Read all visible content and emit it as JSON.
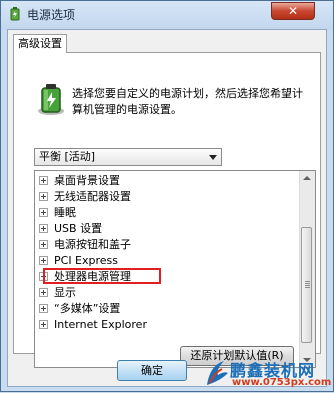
{
  "window": {
    "title": "电源选项",
    "close_glyph": "✕"
  },
  "tabs": [
    {
      "label": "高级设置"
    }
  ],
  "intro_text": "选择您要自定义的电源计划，然后选择您希望计算机管理的电源设置。",
  "plan_select": {
    "value": "平衡 [活动]"
  },
  "settings_tree": [
    {
      "label": "桌面背景设置"
    },
    {
      "label": "无线适配器设置"
    },
    {
      "label": "睡眠"
    },
    {
      "label": "USB 设置"
    },
    {
      "label": "电源按钮和盖子"
    },
    {
      "label": "PCI Express"
    },
    {
      "label": "处理器电源管理",
      "highlighted": true
    },
    {
      "label": "显示"
    },
    {
      "label": "“多媒体”设置"
    },
    {
      "label": "Internet Explorer"
    }
  ],
  "buttons": {
    "restore_defaults": "还原计划默认值(R)",
    "ok": "确定"
  },
  "watermark": {
    "brand": "鹏鑫装机网",
    "url": "www.0753px.com"
  },
  "icons": {
    "app": "power-options-icon",
    "battery": "battery-icon"
  },
  "colors": {
    "highlight_border": "#e02020",
    "titlebar": "#c9dbee"
  }
}
